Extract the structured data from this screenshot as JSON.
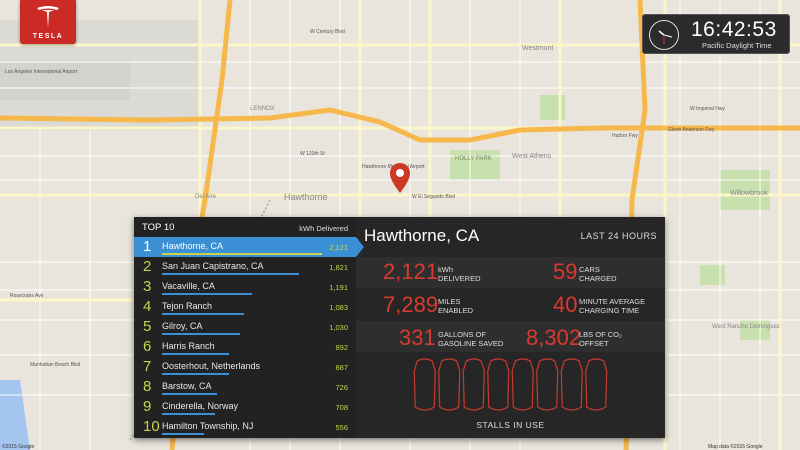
{
  "brand": {
    "name": "TESLA",
    "color": "#cc2a24"
  },
  "clock": {
    "time": "16:42:53",
    "timezone": "Pacific Daylight Time"
  },
  "map": {
    "attribution_left": "©2015 Google",
    "attribution_right": "Map data ©2015 Google",
    "labels": [
      "Los Angeles International Airport",
      "Hawthorne",
      "Hawthorne Municipal Airport",
      "HOLLY PARK",
      "West Athens",
      "Westmont",
      "Willowbrook",
      "LENNOX",
      "W Century Blvd",
      "W 120th St",
      "W El Segundo Blvd",
      "W Imperial Hwy",
      "Glenn Anderson Fwy",
      "Rosecrans Ave",
      "Manhattan Beach Blvd",
      "Del Aire",
      "Harbor Fwy",
      "West Rancho Dominguez"
    ]
  },
  "leaderboard": {
    "title": "TOP 10",
    "units": "kWh Delivered",
    "accent": "#3b8fd4",
    "value_color": "#c7d44a",
    "rows": [
      {
        "rank": "1",
        "name": "Hawthorne, CA",
        "value": "2,121",
        "kwh": 2121,
        "selected": true
      },
      {
        "rank": "2",
        "name": "San Juan Capistrano, CA",
        "value": "1,821",
        "kwh": 1821
      },
      {
        "rank": "3",
        "name": "Vacaville, CA",
        "value": "1,191",
        "kwh": 1191
      },
      {
        "rank": "4",
        "name": "Tejon Ranch",
        "value": "1,083",
        "kwh": 1083
      },
      {
        "rank": "5",
        "name": "Gilroy, CA",
        "value": "1,030",
        "kwh": 1030
      },
      {
        "rank": "6",
        "name": "Harris Ranch",
        "value": "892",
        "kwh": 892
      },
      {
        "rank": "7",
        "name": "Oosterhout, Netherlands",
        "value": "887",
        "kwh": 887
      },
      {
        "rank": "8",
        "name": "Barstow, CA",
        "value": "726",
        "kwh": 726
      },
      {
        "rank": "9",
        "name": "Cinderella, Norway",
        "value": "708",
        "kwh": 708
      },
      {
        "rank": "10",
        "name": "Hamilton Township, NJ",
        "value": "556",
        "kwh": 556
      }
    ]
  },
  "detail": {
    "title": "Hawthorne, CA",
    "period": "LAST 24 HOURS",
    "stat_color": "#d83a2e",
    "stats": {
      "kwh": {
        "value": "2,121",
        "label1": "kWh",
        "label2": "DELIVERED"
      },
      "cars": {
        "value": "59",
        "label1": "CARS",
        "label2": "CHARGED"
      },
      "miles": {
        "value": "7,289",
        "label1": "MILES",
        "label2": "ENABLED"
      },
      "minutes": {
        "value": "40",
        "label1": "MINUTE AVERAGE",
        "label2": "CHARGING TIME"
      },
      "gallons": {
        "value": "331",
        "label1": "GALLONS OF",
        "label2": "GASOLINE SAVED"
      },
      "co2": {
        "value": "8,302",
        "label1": "LBS OF CO₂",
        "label2": "OFFSET"
      }
    },
    "stalls_label": "STALLS IN USE",
    "stalls_total": 8,
    "stalls_in_use": 0
  }
}
